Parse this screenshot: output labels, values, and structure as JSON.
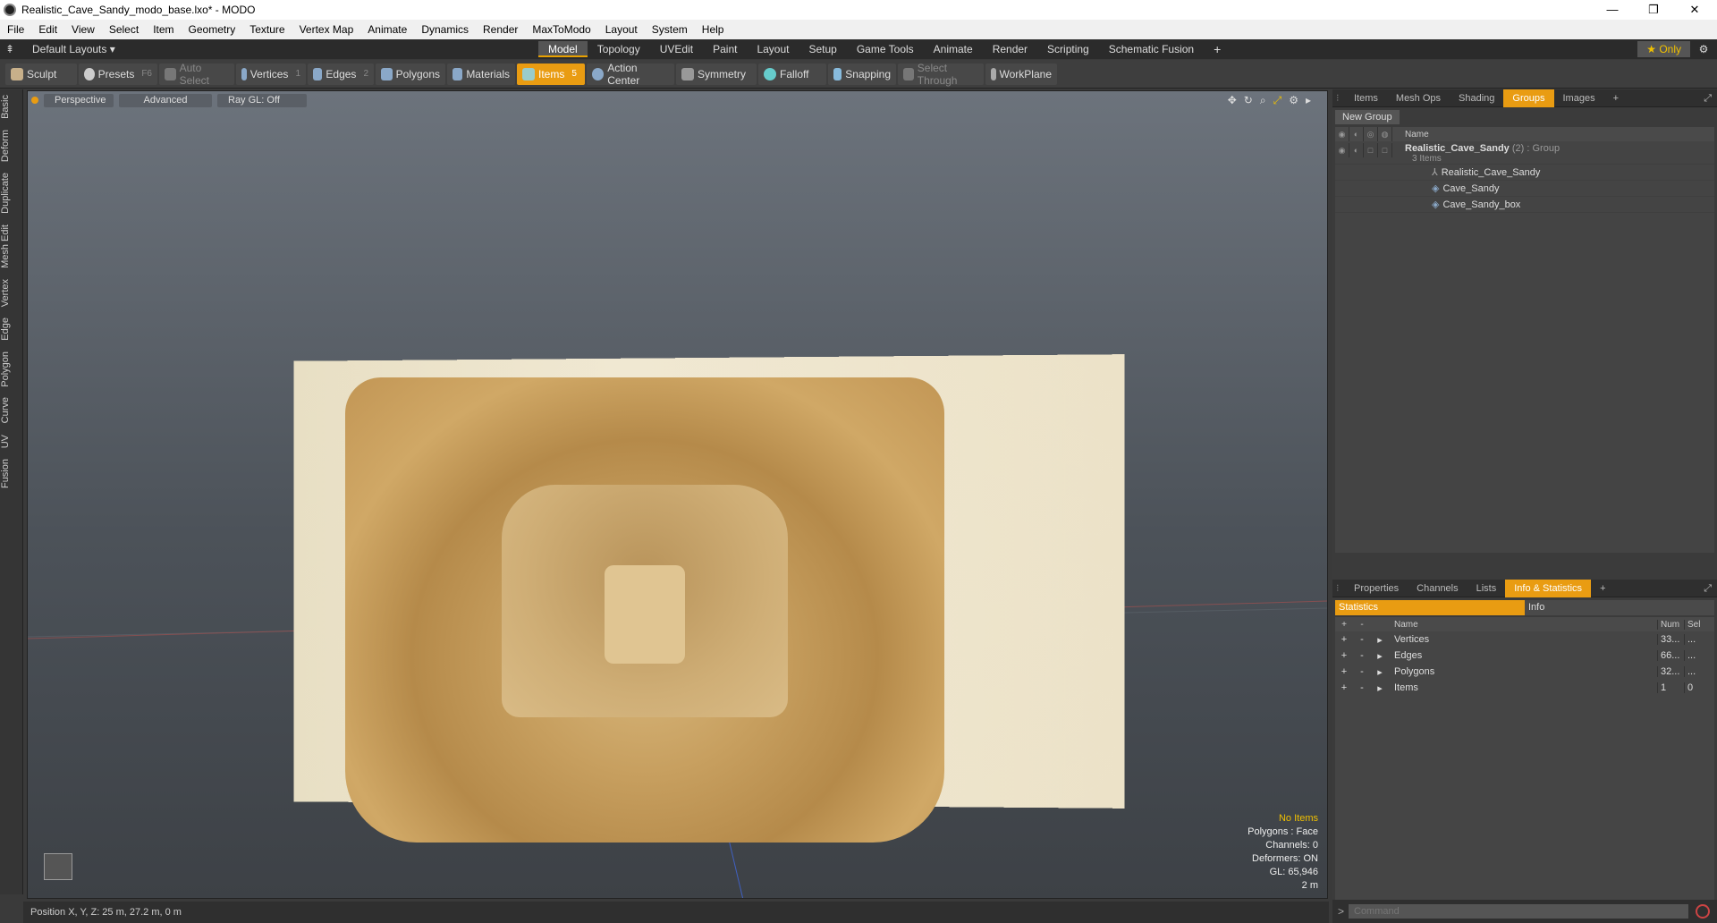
{
  "titlebar": {
    "title": "Realistic_Cave_Sandy_modo_base.lxo* - MODO",
    "minimize": "—",
    "restore": "❐",
    "close": "✕"
  },
  "menubar": {
    "items": [
      "File",
      "Edit",
      "View",
      "Select",
      "Item",
      "Geometry",
      "Texture",
      "Vertex Map",
      "Animate",
      "Dynamics",
      "Render",
      "MaxToModo",
      "Layout",
      "System",
      "Help"
    ]
  },
  "layoutbar": {
    "layouts_label": "Default Layouts ▾",
    "tabs": [
      "Model",
      "Topology",
      "UVEdit",
      "Paint",
      "Layout",
      "Setup",
      "Game Tools",
      "Animate",
      "Render",
      "Scripting",
      "Schematic Fusion"
    ],
    "active_tab": "Model",
    "add": "+",
    "only_label": "★  Only",
    "gear": "⚙"
  },
  "toolbar": {
    "sculpt": "Sculpt",
    "presets": "Presets",
    "presets_key": "F6",
    "auto_select": "Auto Select",
    "vertices": "Vertices",
    "vertices_num": "1",
    "edges": "Edges",
    "edges_num": "2",
    "polygons": "Polygons",
    "materials": "Materials",
    "items": "Items",
    "items_num": "5",
    "action_center": "Action Center",
    "symmetry": "Symmetry",
    "falloff": "Falloff",
    "snapping": "Snapping",
    "select_through": "Select Through",
    "workplane": "WorkPlane"
  },
  "sidetabs": [
    "Basic",
    "Deform",
    "Duplicate",
    "Mesh Edit",
    "Vertex",
    "Edge",
    "Polygon",
    "Curve",
    "UV",
    "Fusion"
  ],
  "viewport": {
    "perspective": "Perspective",
    "advanced": "Advanced",
    "raygl": "Ray GL: Off",
    "hud": {
      "no_items": "No Items",
      "polygons": "Polygons : Face",
      "channels": "Channels: 0",
      "deformers": "Deformers: ON",
      "gl": "GL: 65,946",
      "scale": "2 m"
    }
  },
  "statusbar": {
    "position": "Position X, Y, Z:   25 m, 27.2 m, 0 m"
  },
  "groups_panel": {
    "tabs": [
      "Items",
      "Mesh Ops",
      "Shading",
      "Groups",
      "Images"
    ],
    "active_tab": "Groups",
    "add_tab": "+",
    "new_group": "New Group",
    "name_col": "Name",
    "group": {
      "name": "Realistic_Cave_Sandy",
      "count": "(2)",
      "type": ": Group",
      "sub": "3 Items"
    },
    "items": [
      "Realistic_Cave_Sandy",
      "Cave_Sandy",
      "Cave_Sandy_box"
    ]
  },
  "stats_panel": {
    "tabs": [
      "Properties",
      "Channels",
      "Lists",
      "Info & Statistics"
    ],
    "active_tab": "Info & Statistics",
    "add_tab": "+",
    "subtabs": [
      "Statistics",
      "Info"
    ],
    "columns": {
      "name": "Name",
      "num": "Num",
      "sel": "Sel"
    },
    "rows": [
      {
        "name": "Vertices",
        "num": "33...",
        "sel": "..."
      },
      {
        "name": "Edges",
        "num": "66...",
        "sel": "..."
      },
      {
        "name": "Polygons",
        "num": "32...",
        "sel": "..."
      },
      {
        "name": "Items",
        "num": "1",
        "sel": "0"
      }
    ]
  },
  "command": {
    "placeholder": "Command",
    "prompt": ">"
  }
}
